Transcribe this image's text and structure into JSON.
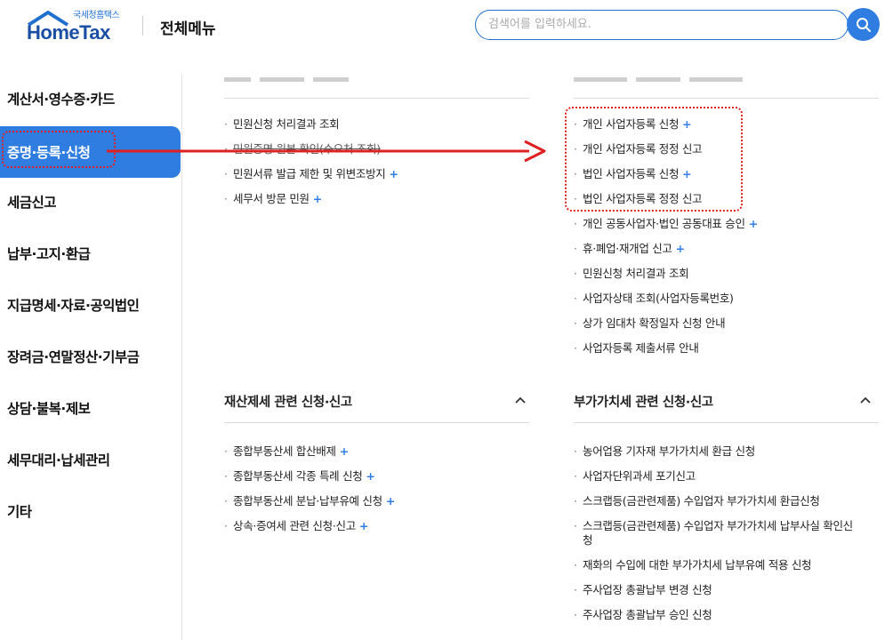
{
  "header": {
    "logo_small": "국세청홈택스",
    "logo_main": "HomeTax",
    "title": "전체메뉴",
    "search_placeholder": "검색어를 입력하세요."
  },
  "sidebar": {
    "items": [
      {
        "label": "계산서·영수증·카드"
      },
      {
        "label": "증명·등록·신청"
      },
      {
        "label": "세금신고"
      },
      {
        "label": "납부·고지·환급"
      },
      {
        "label": "지급명세·자료·공익법인"
      },
      {
        "label": "장려금·연말정산·기부금"
      },
      {
        "label": "상담·불복·제보"
      },
      {
        "label": "세무대리·납세관리"
      },
      {
        "label": "기타"
      }
    ]
  },
  "left_top_links": [
    {
      "label": "민원신청 처리결과 조회",
      "plus": ""
    },
    {
      "label": "민원증명 원본 확인(수요처 조회)",
      "plus": ""
    },
    {
      "label": "민원서류 발급 제한 및 위변조방지",
      "plus": "+"
    },
    {
      "label": "세무서 방문 민원",
      "plus": "+"
    }
  ],
  "right_top_links": [
    {
      "label": "개인 사업자등록 신청",
      "plus": "+"
    },
    {
      "label": "개인 사업자등록 정정 신고",
      "plus": ""
    },
    {
      "label": "법인 사업자등록 신청",
      "plus": "+"
    },
    {
      "label": "법인 사업자등록 정정 신고",
      "plus": ""
    },
    {
      "label": "개인 공동사업자·법인 공동대표 승인",
      "plus": "+"
    },
    {
      "label": "휴·폐업·재개업 신고",
      "plus": "+"
    },
    {
      "label": "민원신청 처리결과 조회",
      "plus": ""
    },
    {
      "label": "사업자상태 조회(사업자등록번호)",
      "plus": ""
    },
    {
      "label": "상가 임대차 확정일자 신청 안내",
      "plus": ""
    },
    {
      "label": "사업자등록 제출서류 안내",
      "plus": ""
    }
  ],
  "property_section": {
    "title": "재산제세 관련 신청·신고",
    "links": [
      {
        "label": "종합부동산세 합산배제",
        "plus": "+"
      },
      {
        "label": "종합부동산세 각종 특례 신청",
        "plus": "+"
      },
      {
        "label": "종합부동산세 분납·납부유예 신청",
        "plus": "+"
      },
      {
        "label": "상속·증여세 관련 신청·신고",
        "plus": "+"
      }
    ]
  },
  "vat_section": {
    "title": "부가가치세 관련 신청·신고",
    "links": [
      {
        "label": "농어업용 기자재 부가가치세 환급 신청",
        "plus": ""
      },
      {
        "label": "사업자단위과세 포기신고",
        "plus": ""
      },
      {
        "label": "스크랩등(금관련제품) 수입업자 부가가치세 환급신청",
        "plus": ""
      },
      {
        "label": "스크랩등(금관련제품) 수입업자 부가가치세 납부사실 확인신청",
        "plus": ""
      },
      {
        "label": "재화의 수입에 대한 부가가치세 납부유예 적용 신청",
        "plus": ""
      },
      {
        "label": "주사업장 총괄납부 변경 신청",
        "plus": ""
      },
      {
        "label": "주사업장 총괄납부 승인 신청",
        "plus": ""
      }
    ]
  },
  "colors": {
    "accent": "#2f7de0",
    "annotation": "#e02020"
  }
}
